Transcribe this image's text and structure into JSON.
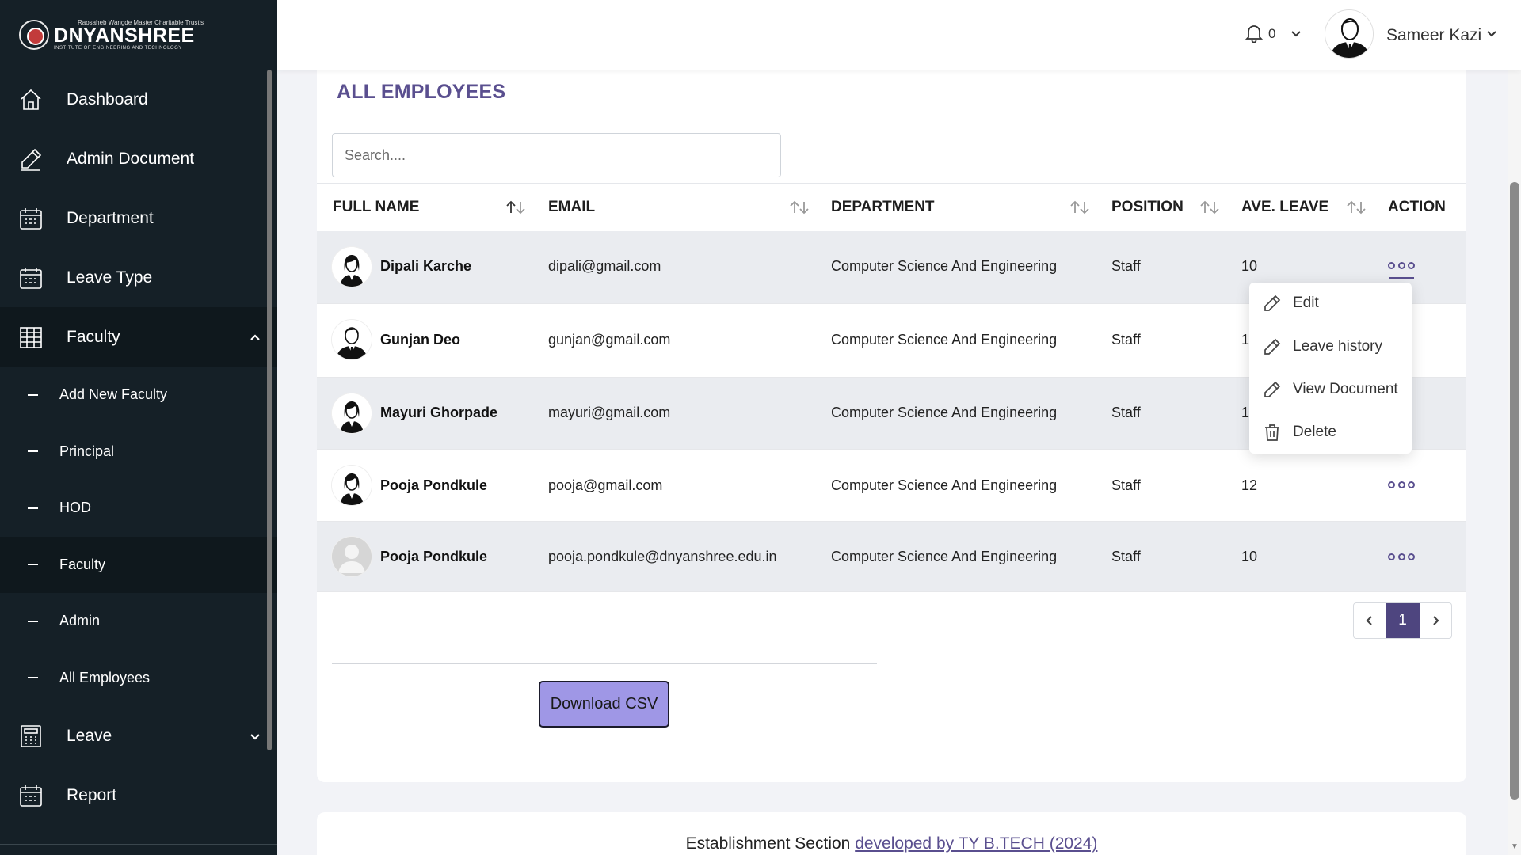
{
  "brand": {
    "top_line": "Raosaheb Wangde Master Charitable Trust's",
    "name": "DNYANSHREE",
    "subtitle": "INSTITUTE OF ENGINEERING AND TECHNOLOGY"
  },
  "sidebar": {
    "items": [
      {
        "label": "Dashboard",
        "icon": "home-icon"
      },
      {
        "label": "Admin Document",
        "icon": "pencil-icon"
      },
      {
        "label": "Department",
        "icon": "calendar-icon"
      },
      {
        "label": "Leave Type",
        "icon": "calendar-icon"
      },
      {
        "label": "Faculty",
        "icon": "grid-icon"
      },
      {
        "label": "Leave",
        "icon": "calculator-icon"
      },
      {
        "label": "Report",
        "icon": "calendar-icon"
      }
    ],
    "faculty_sub": [
      {
        "label": "Add New Faculty"
      },
      {
        "label": "Principal"
      },
      {
        "label": "HOD"
      },
      {
        "label": "Faculty"
      },
      {
        "label": "Admin"
      },
      {
        "label": "All Employees"
      }
    ]
  },
  "topbar": {
    "notification_count": "0",
    "user_name": "Sameer Kazi"
  },
  "main": {
    "title": "ALL EMPLOYEES",
    "search_placeholder": "Search....",
    "columns": [
      "FULL NAME",
      "EMAIL",
      "DEPARTMENT",
      "POSITION",
      "AVE. LEAVE",
      "ACTION"
    ],
    "rows": [
      {
        "name": "Dipali Karche",
        "email": "dipali@gmail.com",
        "department": "Computer Science And Engineering",
        "position": "Staff",
        "leave": "10",
        "avatar": "female"
      },
      {
        "name": "Gunjan Deo",
        "email": "gunjan@gmail.com",
        "department": "Computer Science And Engineering",
        "position": "Staff",
        "leave": "1",
        "avatar": "male"
      },
      {
        "name": "Mayuri Ghorpade",
        "email": "mayuri@gmail.com",
        "department": "Computer Science And Engineering",
        "position": "Staff",
        "leave": "1",
        "avatar": "female"
      },
      {
        "name": "Pooja Pondkule",
        "email": "pooja@gmail.com",
        "department": "Computer Science And Engineering",
        "position": "Staff",
        "leave": "12",
        "avatar": "female"
      },
      {
        "name": "Pooja Pondkule",
        "email": "pooja.pondkule@dnyanshree.edu.in",
        "department": "Computer Science And Engineering",
        "position": "Staff",
        "leave": "10",
        "avatar": "default"
      }
    ],
    "action_menu": [
      "Edit",
      "Leave history",
      "View Document",
      "Delete"
    ],
    "pagination": {
      "current_page": "1"
    },
    "download_label": "Download CSV"
  },
  "footer": {
    "text": "Establishment Section",
    "link": "developed by TY B.TECH (2024)"
  },
  "colors": {
    "sidebar_bg": "#152027",
    "accent": "#5a4f8f",
    "csv_button": "#9f97e6",
    "page_active": "#4e457f"
  }
}
